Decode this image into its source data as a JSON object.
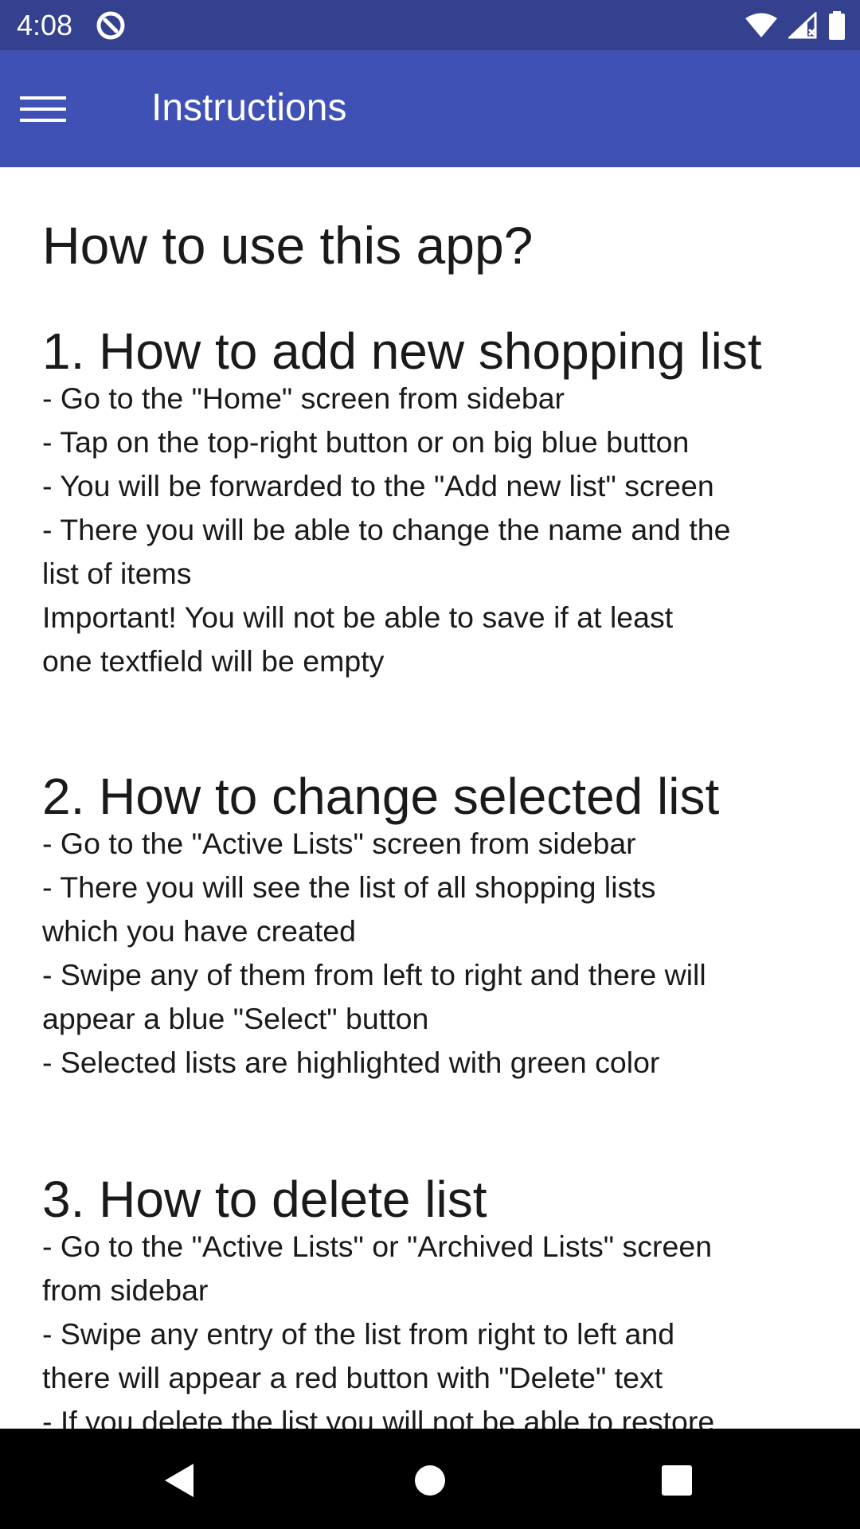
{
  "status_bar": {
    "time": "4:08",
    "background": "#33418f",
    "icons": [
      "app-notification-icon",
      "wifi-icon",
      "signal-icon",
      "battery-icon"
    ]
  },
  "app_bar": {
    "title": "Instructions",
    "background": "#3f51b5",
    "menu_icon": "hamburger-menu-icon"
  },
  "content": {
    "page_heading": "How to use this app?",
    "sections": [
      {
        "heading": "1. How to add new shopping list",
        "lines": [
          "- Go to the \"Home\" screen from sidebar",
          "- Tap on the top-right button or on big blue button",
          "- You will be forwarded to the \"Add new list\" screen",
          "- There you will be able to change the name and the",
          "list of items",
          "Important! You will not be able to save if at least",
          "one textfield will be empty"
        ]
      },
      {
        "heading": "2. How to change selected list",
        "lines": [
          "- Go to the \"Active Lists\" screen from sidebar",
          "- There you will see the list of all shopping lists",
          "which you have created",
          "- Swipe any of them from left to right and there will",
          "appear a blue \"Select\" button",
          "- Selected lists are highlighted with green color"
        ]
      },
      {
        "heading": "3. How to delete list",
        "lines": [
          "- Go to the \"Active Lists\" or \"Archived Lists\" screen",
          "from sidebar",
          "- Swipe any entry of the list from right to left and",
          "there will appear a red button with \"Delete\" text",
          "- If you delete the list you will not be able to restore"
        ]
      }
    ]
  },
  "nav_bar": {
    "background": "#000000",
    "buttons": [
      "back-icon",
      "home-icon",
      "recents-icon"
    ]
  }
}
